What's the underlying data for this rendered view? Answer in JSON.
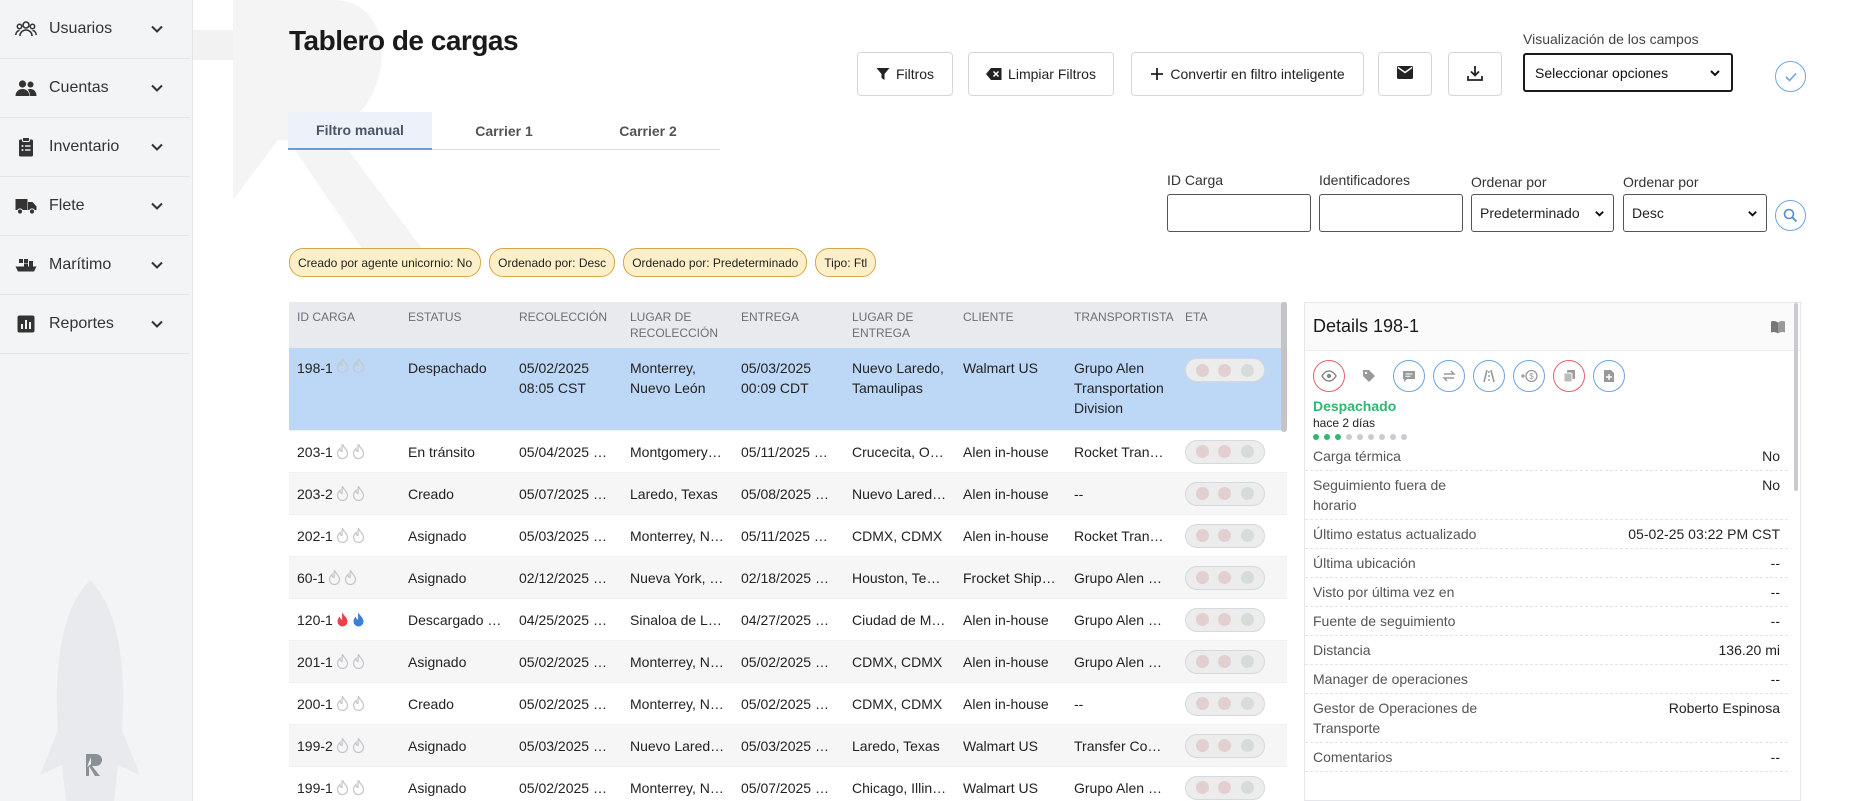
{
  "sidebar": {
    "items": [
      {
        "label": "Usuarios",
        "icon": "users-icon"
      },
      {
        "label": "Cuentas",
        "icon": "accounts-icon"
      },
      {
        "label": "Inventario",
        "icon": "clipboard-icon"
      },
      {
        "label": "Flete",
        "icon": "truck-icon"
      },
      {
        "label": "Marítimo",
        "icon": "ship-icon"
      },
      {
        "label": "Reportes",
        "icon": "chart-icon"
      }
    ]
  },
  "header": {
    "title": "Tablero de cargas",
    "buttons": {
      "filters": "Filtros",
      "clear": "Limpiar Filtros",
      "smart": "Convertir en filtro inteligente"
    },
    "visualization_label": "Visualización de los campos",
    "visualization_value": "Seleccionar opciones"
  },
  "tabs": [
    "Filtro manual",
    "Carrier 1",
    "Carrier 2"
  ],
  "filters": {
    "id_label": "ID Carga",
    "identifiers_label": "Identificadores",
    "order_label_1": "Ordenar por",
    "order_value_1": "Predeterminado",
    "order_label_2": "Ordenar por",
    "order_value_2": "Desc"
  },
  "chips": [
    "Creado por agente unicornio: No",
    "Ordenado por: Desc",
    "Ordenado por: Predeterminado",
    "Tipo: Ftl"
  ],
  "table": {
    "headers": [
      "ID CARGA",
      "ESTATUS",
      "RECOLECCIÓN",
      "LUGAR DE RECOLECCIÓN",
      "ENTREGA",
      "LUGAR DE ENTREGA",
      "CLIENTE",
      "TRANSPORTISTA",
      "ETA"
    ],
    "rows": [
      {
        "id": "198-1",
        "status": "Despachado",
        "pickup": "05/02/2025 08:05 CST",
        "pickup_place": "Monterrey, Nuevo León",
        "delivery": "05/03/2025 00:09 CDT",
        "delivery_place": "Nuevo Laredo, Tamaulipas",
        "client": "Walmart US",
        "carrier": "Grupo Alen Transportation Division"
      },
      {
        "id": "203-1",
        "status": "En tránsito",
        "pickup": "05/04/2025 …",
        "pickup_place": "Montgomery…",
        "delivery": "05/11/2025 …",
        "delivery_place": "Crucecita, O…",
        "client": "Alen in-house",
        "carrier": "Rocket Tran…"
      },
      {
        "id": "203-2",
        "status": "Creado",
        "pickup": "05/07/2025 …",
        "pickup_place": "Laredo, Texas",
        "delivery": "05/08/2025 …",
        "delivery_place": "Nuevo Lared…",
        "client": "Alen in-house",
        "carrier": "--"
      },
      {
        "id": "202-1",
        "status": "Asignado",
        "pickup": "05/03/2025 …",
        "pickup_place": "Monterrey, N…",
        "delivery": "05/11/2025 …",
        "delivery_place": "CDMX, CDMX",
        "client": "Alen in-house",
        "carrier": "Rocket Tran…"
      },
      {
        "id": "60-1",
        "status": "Asignado",
        "pickup": "02/12/2025 …",
        "pickup_place": "Nueva York, …",
        "delivery": "02/18/2025 …",
        "delivery_place": "Houston, Te…",
        "client": "Frocket Ship…",
        "carrier": "Grupo Alen …"
      },
      {
        "id": "120-1",
        "status": "Descargado …",
        "pickup": "04/25/2025 …",
        "pickup_place": "Sinaloa de L…",
        "delivery": "04/27/2025 …",
        "delivery_place": "Ciudad de M…",
        "client": "Alen in-house",
        "carrier": "Grupo Alen …",
        "hot": true
      },
      {
        "id": "201-1",
        "status": "Asignado",
        "pickup": "05/02/2025 …",
        "pickup_place": "Monterrey, N…",
        "delivery": "05/02/2025 …",
        "delivery_place": "CDMX, CDMX",
        "client": "Alen in-house",
        "carrier": "Grupo Alen …"
      },
      {
        "id": "200-1",
        "status": "Creado",
        "pickup": "05/02/2025 …",
        "pickup_place": "Monterrey, N…",
        "delivery": "05/02/2025 …",
        "delivery_place": "CDMX, CDMX",
        "client": "Alen in-house",
        "carrier": "--"
      },
      {
        "id": "199-2",
        "status": "Asignado",
        "pickup": "05/03/2025 …",
        "pickup_place": "Nuevo Lared…",
        "delivery": "05/03/2025 …",
        "delivery_place": "Laredo, Texas",
        "client": "Walmart US",
        "carrier": "Transfer Co…"
      },
      {
        "id": "199-1",
        "status": "Asignado",
        "pickup": "05/02/2025 …",
        "pickup_place": "Monterrey, N…",
        "delivery": "05/07/2025 …",
        "delivery_place": "Chicago, Illin…",
        "client": "Walmart US",
        "carrier": "Grupo Alen …"
      }
    ]
  },
  "details": {
    "title": "Details 198-1",
    "status": "Despachado",
    "ago": "hace 2 días",
    "progress_steps_done": 3,
    "progress_steps_total": 9,
    "fields": [
      {
        "label": "Carga térmica",
        "value": "No"
      },
      {
        "label": "Seguimiento fuera de horario",
        "value": "No"
      },
      {
        "label": "Último estatus actualizado",
        "value": "05-02-25 03:22 PM CST"
      },
      {
        "label": "Última ubicación",
        "value": "--"
      },
      {
        "label": "Visto por última vez en",
        "value": "--"
      },
      {
        "label": "Fuente de seguimiento",
        "value": "--"
      },
      {
        "label": "Distancia",
        "value": "136.20 mi"
      },
      {
        "label": "Manager de operaciones",
        "value": "--"
      },
      {
        "label": "Gestor de Operaciones de Transporte",
        "value": "Roberto Espinosa"
      },
      {
        "label": "Comentarios",
        "value": "--"
      }
    ]
  },
  "colors": {
    "accent": "#6c9ad6",
    "selected_row": "#bcd8f6",
    "chip_bg": "#fdf0c8",
    "status_green": "#2eb872"
  }
}
